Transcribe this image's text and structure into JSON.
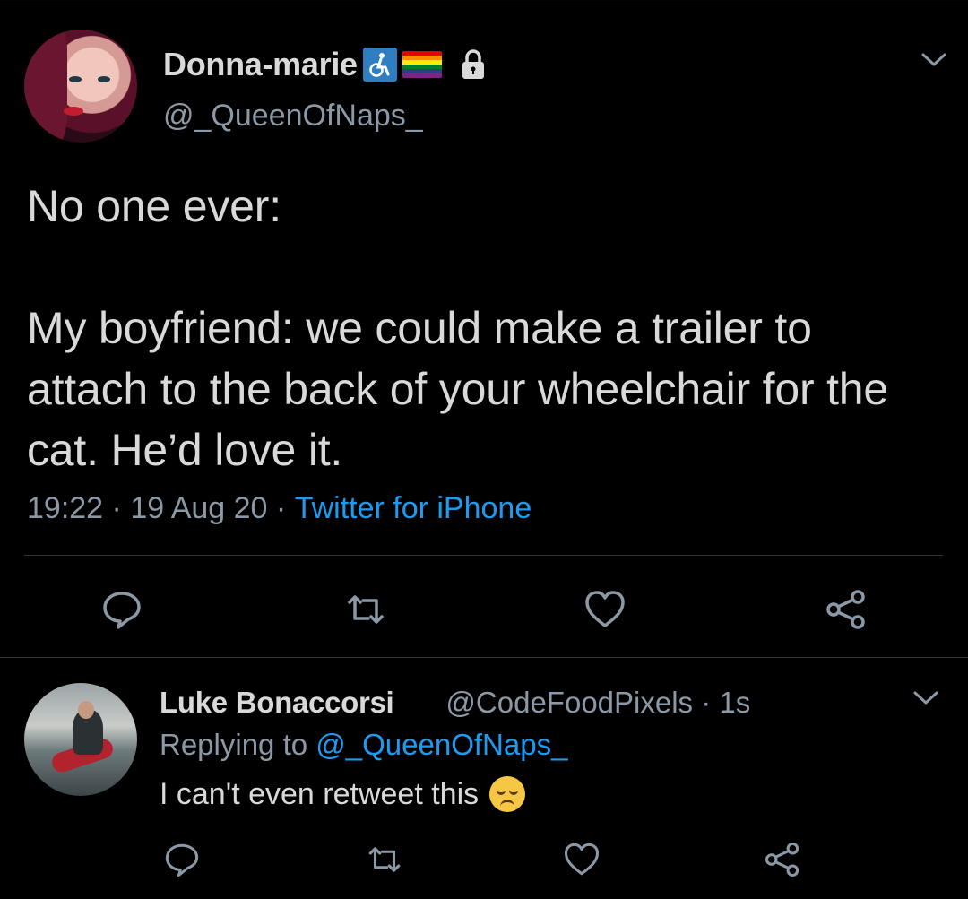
{
  "tweet": {
    "display_name": "Donna-marie",
    "handle": "@_QueenOfNaps_",
    "badges": [
      "wheelchair-icon",
      "rainbow-flag-icon",
      "lock-icon"
    ],
    "text": "No one ever:\n\nMy boyfriend: we could make a trailer to attach to the back of your wheelchair for the cat. He’d love it.",
    "time": "19:22",
    "date": "19 Aug 20",
    "separator": " · ",
    "source": "Twitter for iPhone"
  },
  "actions": [
    "reply-icon",
    "retweet-icon",
    "like-icon",
    "share-icon"
  ],
  "reply": {
    "display_name": "Luke Bonaccorsi",
    "handle": "@CodeFoodPixels",
    "age": " · 1s",
    "replying_prefix": "Replying to ",
    "replying_to": "@_QueenOfNaps_",
    "text": "I can't even retweet this",
    "emoji": "disappointed-face-emoji"
  },
  "colors": {
    "background": "#000000",
    "text": "#d9d9d9",
    "muted": "#8b98a5",
    "link": "#1d9bf0",
    "divider": "#2f3336",
    "rainbow": [
      "#e40303",
      "#ff8c00",
      "#ffed00",
      "#008026",
      "#24408e",
      "#732982"
    ]
  }
}
